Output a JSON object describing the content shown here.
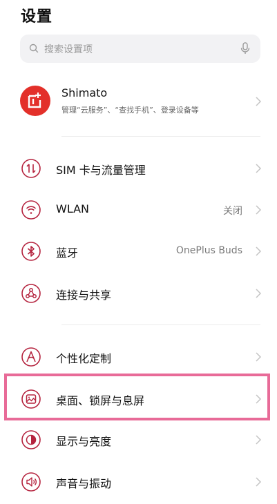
{
  "page": {
    "title": "设置"
  },
  "search": {
    "placeholder": "搜索设置项"
  },
  "account": {
    "name": "Shimato",
    "description": "管理“云服务”、“查找手机”、登录设备等"
  },
  "items": [
    {
      "label": "SIM 卡与流量管理",
      "value": "",
      "icon": "sim-data-icon"
    },
    {
      "label": "WLAN",
      "value": "关闭",
      "icon": "wifi-icon"
    },
    {
      "label": "蓝牙",
      "value": "OnePlus Buds",
      "icon": "bluetooth-icon"
    },
    {
      "label": "连接与共享",
      "value": "",
      "icon": "share-icon"
    },
    {
      "label": "个性化定制",
      "value": "",
      "icon": "personalize-icon"
    },
    {
      "label": "桌面、锁屏与息屏",
      "value": "",
      "icon": "wallpaper-icon"
    },
    {
      "label": "显示与亮度",
      "value": "",
      "icon": "brightness-icon"
    },
    {
      "label": "声音与振动",
      "value": "",
      "icon": "sound-icon"
    }
  ],
  "colors": {
    "accent": "#b5243f",
    "avatar": "#e3302a",
    "highlight": "#e86b98",
    "search_bg": "#f2f2f4"
  }
}
